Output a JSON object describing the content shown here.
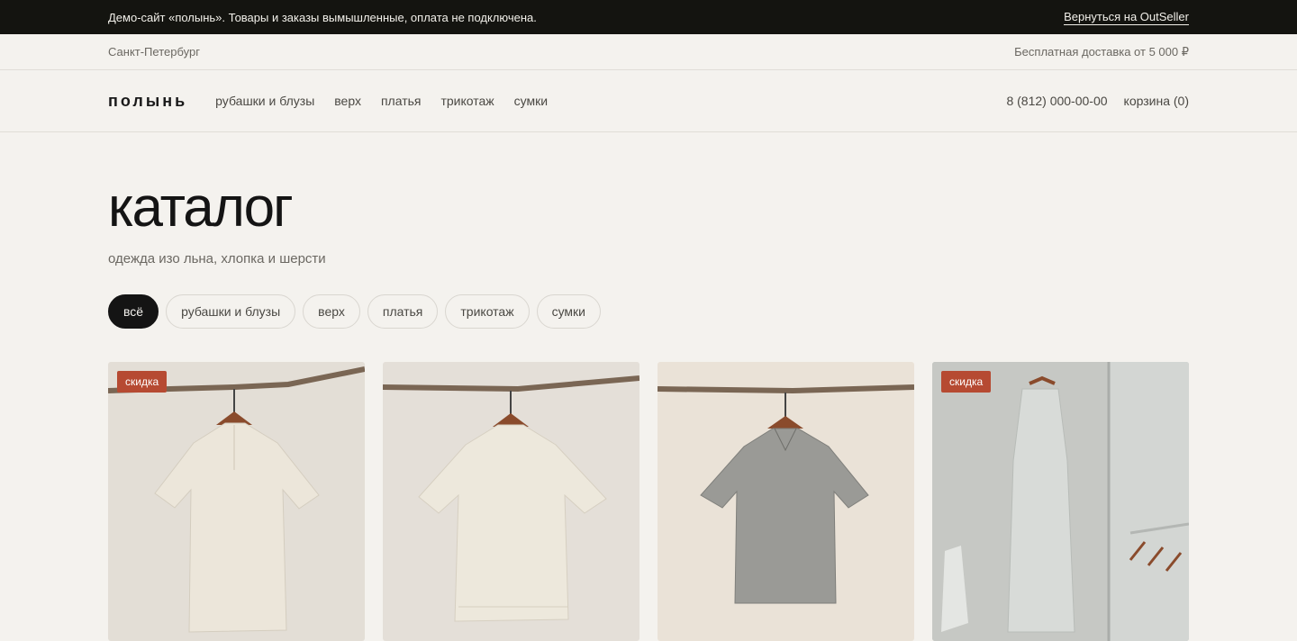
{
  "topbar": {
    "notice": "Демо-сайт «полынь». Товары и заказы вымышленные, оплата не подключена.",
    "back_link": "Вернуться на OutSeller"
  },
  "subbar": {
    "city": "Санкт-Петербург",
    "delivery": "Бесплатная доставка от 5 000 ₽"
  },
  "header": {
    "logo": "полынь",
    "nav": [
      "рубашки и блузы",
      "верх",
      "платья",
      "трикотаж",
      "сумки"
    ],
    "phone": "8 (812) 000-00-00",
    "cart": "корзина (0)"
  },
  "catalog": {
    "title": "каталог",
    "subtitle": "одежда изо льна, хлопка и шерсти",
    "filters": [
      "всё",
      "рубашки и блузы",
      "верх",
      "платья",
      "трикотаж",
      "сумки"
    ],
    "active_filter": "всё"
  },
  "products": [
    {
      "badge": "скидка",
      "bg": "#e3ded6",
      "garment": "#ece6da"
    },
    {
      "badge": "",
      "bg": "#e4dfd8",
      "garment": "#ede8dc"
    },
    {
      "badge": "",
      "bg": "#eae2d7",
      "garment": "#9a9a96"
    },
    {
      "badge": "скидка",
      "bg": "#c9cac6",
      "garment": "#d8dbd8"
    }
  ],
  "colors": {
    "accent_dark": "#141410",
    "badge": "#b64a32",
    "background": "#f4f2ee"
  }
}
